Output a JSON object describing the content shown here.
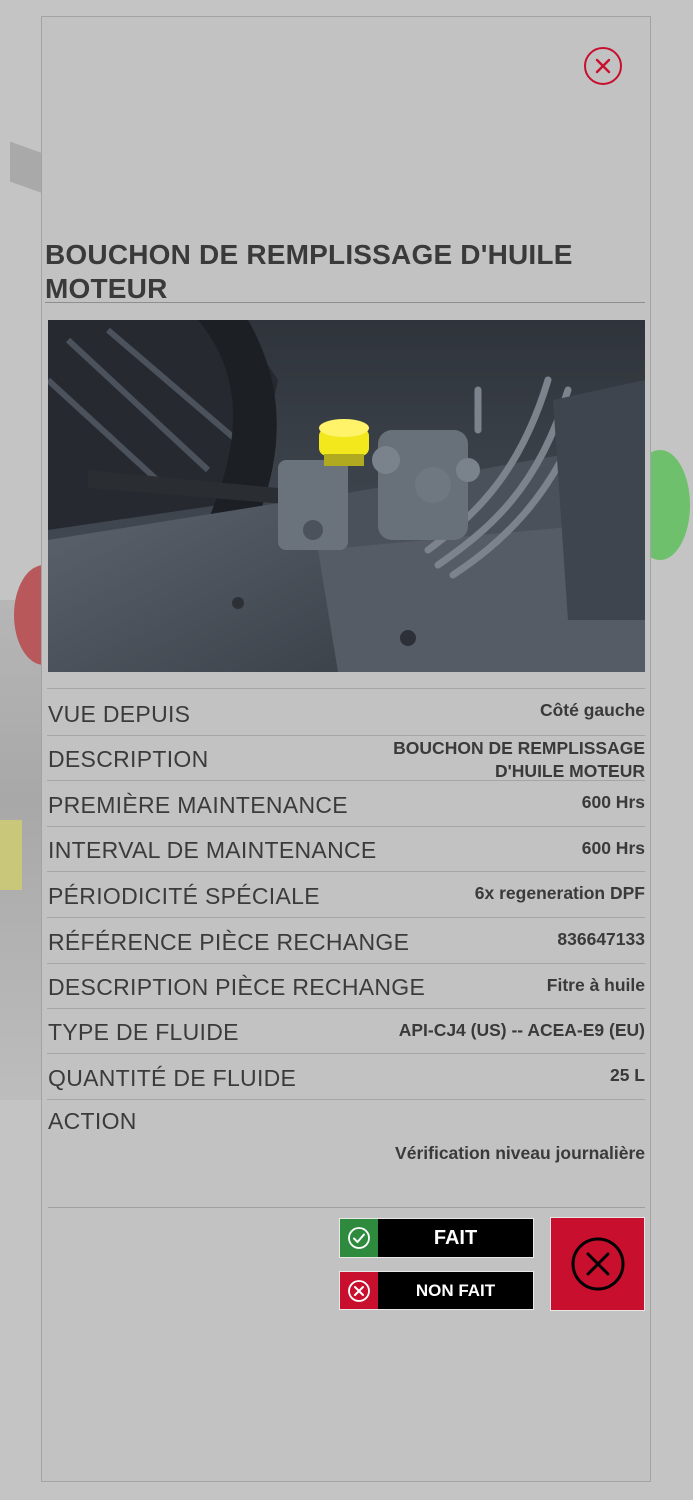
{
  "title": "BOUCHON DE REMPLISSAGE D'HUILE MOTEUR",
  "details": [
    {
      "label": "VUE DEPUIS",
      "value": "Côté gauche"
    },
    {
      "label": "DESCRIPTION",
      "value": "BOUCHON DE REMPLISSAGE D'HUILE MOTEUR"
    },
    {
      "label": "PREMIÈRE MAINTENANCE",
      "value": "600 Hrs"
    },
    {
      "label": "INTERVAL DE MAINTENANCE",
      "value": "600 Hrs"
    },
    {
      "label": "PÉRIODICITÉ SPÉCIALE",
      "value": "6x regeneration DPF"
    },
    {
      "label": "RÉFÉRENCE PIÈCE RECHANGE",
      "value": "836647133"
    },
    {
      "label": "DESCRIPTION PIÈCE RECHANGE",
      "value": "Fitre à huile"
    },
    {
      "label": "TYPE DE FLUIDE",
      "value": "API-CJ4 (US) -- ACEA-E9 (EU)"
    },
    {
      "label": "QUANTITÉ DE FLUIDE",
      "value": "25 L"
    },
    {
      "label": "ACTION",
      "value": "Vérification niveau journalière"
    }
  ],
  "buttons": {
    "done_label": "FAIT",
    "not_done_label": "NON FAIT"
  },
  "icons": {
    "close": "close-icon",
    "done": "check-circle-icon",
    "not_done": "x-circle-icon",
    "cancel": "x-circle-icon"
  },
  "colors": {
    "accent_red": "#c8102e",
    "done_green": "#2e8b3e",
    "highlight_yellow": "#f2e81c"
  }
}
